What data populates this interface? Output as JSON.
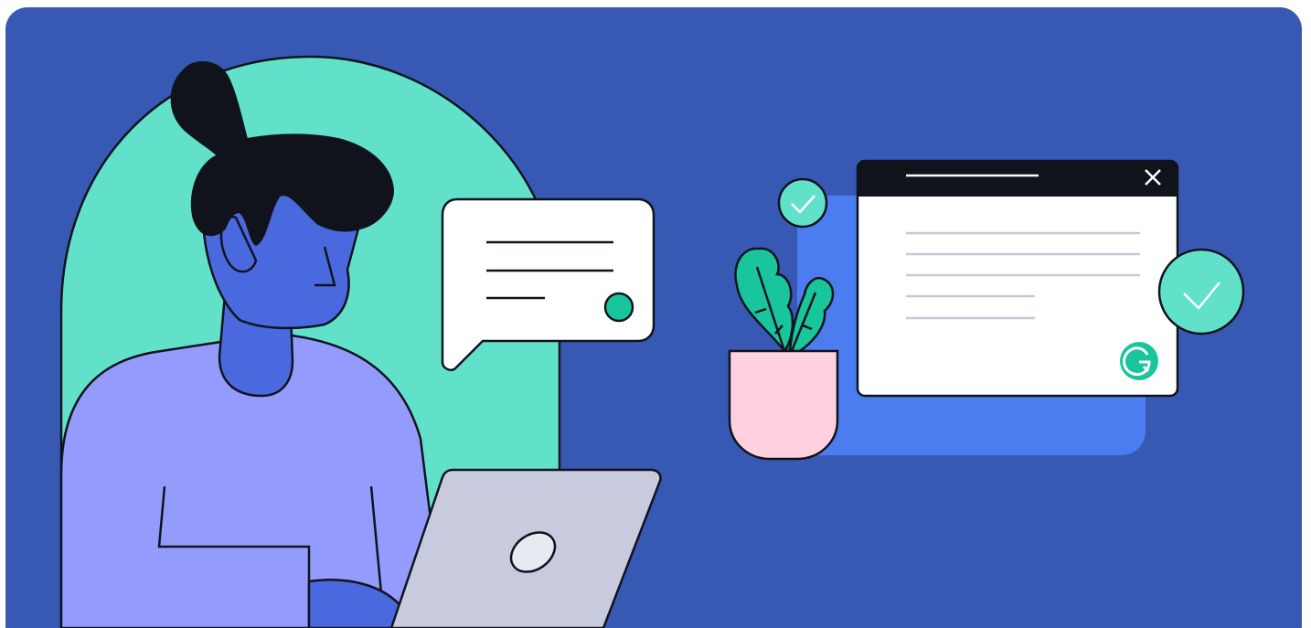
{
  "colors": {
    "background": "#3759B4",
    "mint": "#62E1CA",
    "sweater": "#939CFD",
    "skin": "#4A69DE",
    "hair": "#11131C",
    "laptop": "#C7CBDD",
    "panel_blue": "#4B7CF0",
    "window_bar": "#11131C",
    "window_lines": "#C4C9D8",
    "pot": "#FFD1E0",
    "leaf": "#19C59D",
    "check_circle": "#62E1CA",
    "grammarly_green": "#19C59D"
  },
  "icons": {
    "window_close": "close-icon",
    "check_small": "checkmark-icon",
    "check_large": "checkmark-icon",
    "brand_logo": "grammarly-logo-icon",
    "laptop_logo": "laptop-logo-icon",
    "chat_status": "status-dot-icon"
  }
}
